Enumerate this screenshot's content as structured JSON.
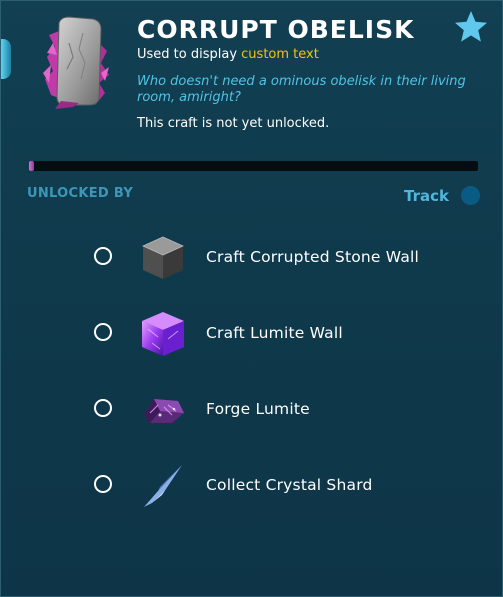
{
  "item": {
    "title": "CORRUPT OBELISK",
    "subtitle_prefix": "Used to display ",
    "subtitle_highlight": "custom text",
    "flavor_text": "Who doesn't need a ominous obelisk in their living room, amiright?",
    "lock_status": "This craft is not yet unlocked.",
    "icon": "corrupt-obelisk-icon",
    "favorite_icon": "star-icon",
    "unlock_progress": 0.01
  },
  "unlocks": {
    "header": "UNLOCKED BY",
    "track_label": "Track",
    "requirements": [
      {
        "label": "Craft Corrupted Stone Wall",
        "icon": "corrupted-stone-wall-icon",
        "completed": false
      },
      {
        "label": "Craft Lumite Wall",
        "icon": "lumite-wall-icon",
        "completed": false
      },
      {
        "label": "Forge Lumite",
        "icon": "lumite-bar-icon",
        "completed": false
      },
      {
        "label": "Collect Crystal Shard",
        "icon": "crystal-shard-icon",
        "completed": false
      }
    ]
  },
  "colors": {
    "accent_yellow": "#f2c40b",
    "flavor_blue": "#4fc4e6",
    "header_blue": "#3d97b8",
    "track_blue": "#4fb6dc",
    "star_blue": "#5fc8ec"
  }
}
